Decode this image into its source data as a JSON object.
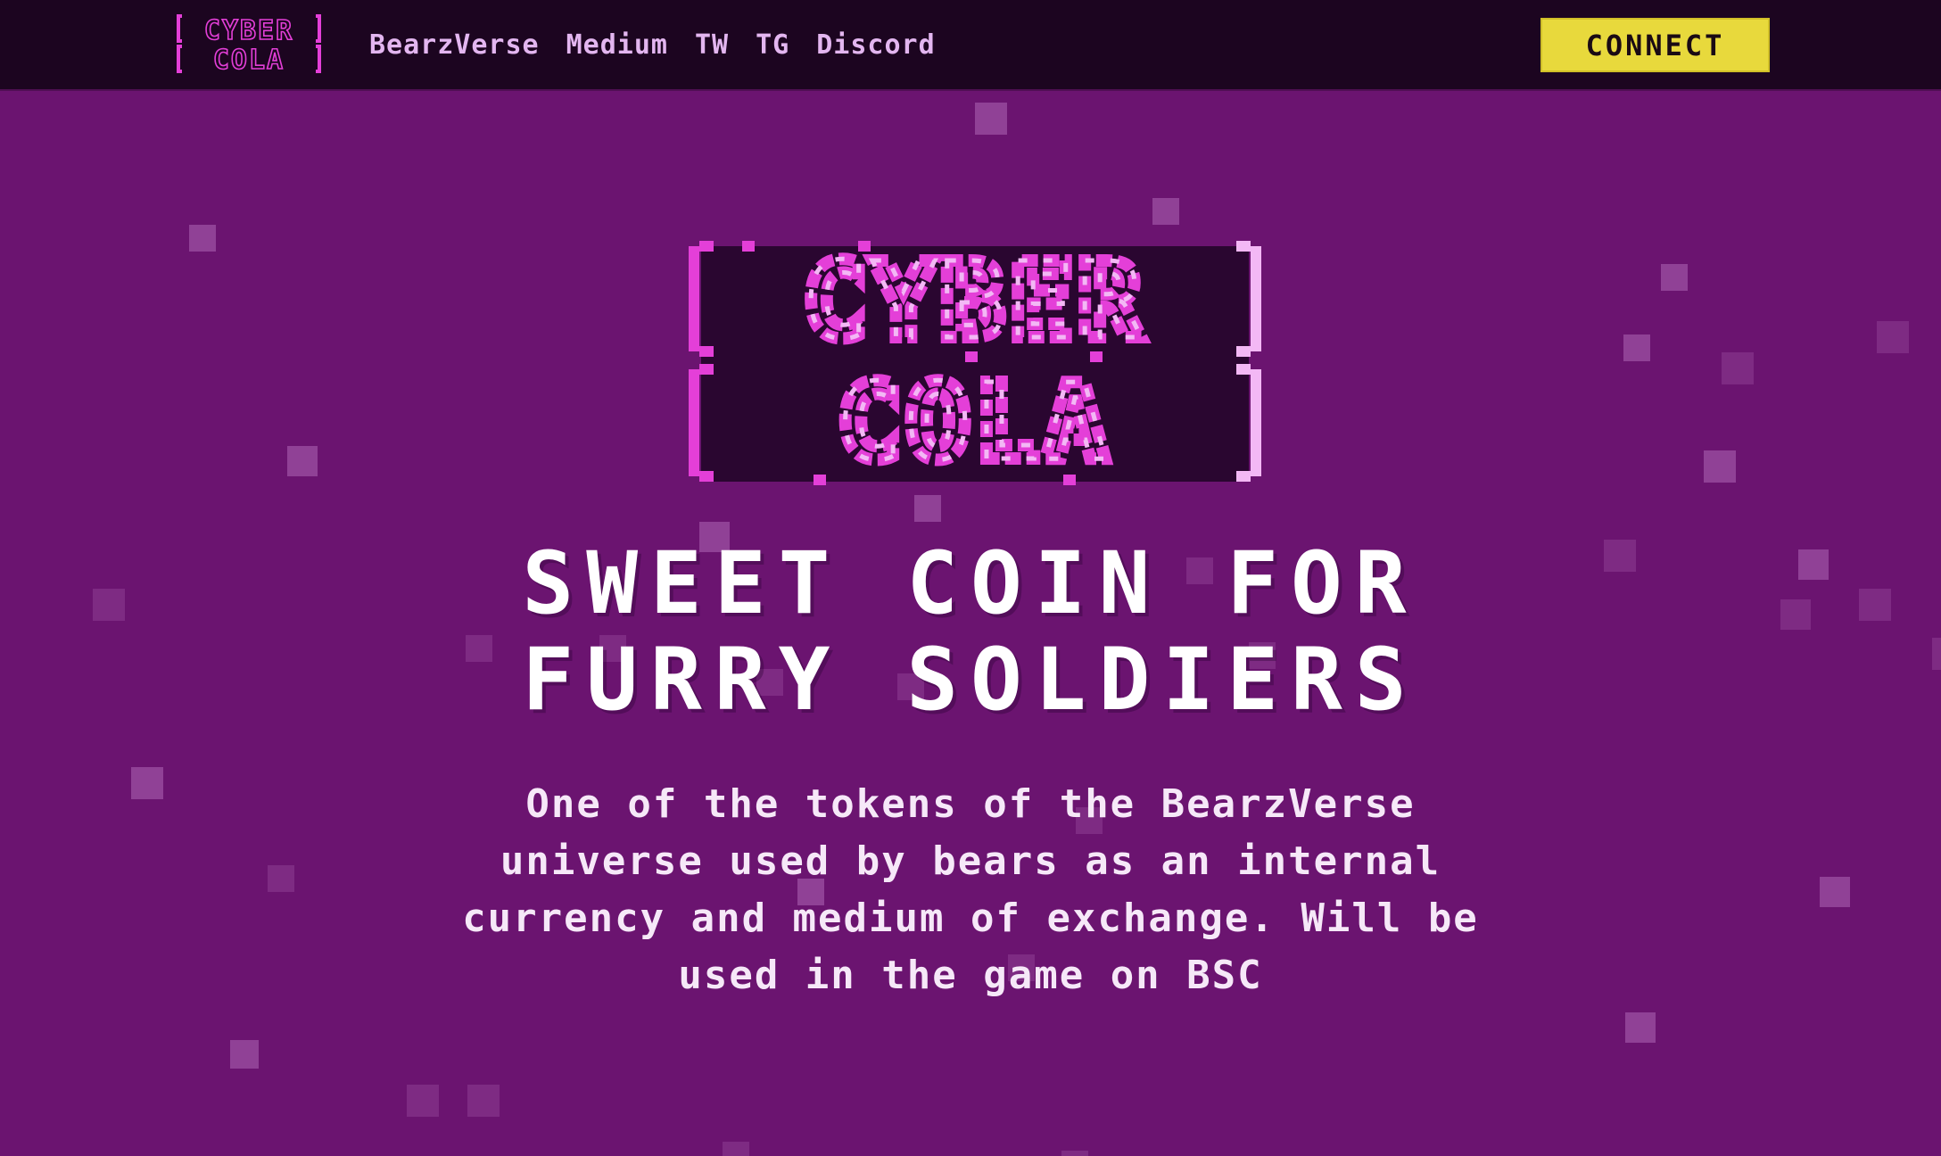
{
  "nav": {
    "logo_text": "CYBER COLA",
    "links": [
      "BearzVerse",
      "Medium",
      "TW",
      "TG",
      "Discord"
    ],
    "connect_label": "CONNECT"
  },
  "hero": {
    "logo_text": "CYBER COLA",
    "headline_line1": "SWEET COIN FOR",
    "headline_line2": "FURRY SOLDIERS",
    "description": "One of the tokens of the BearzVerse universe used by bears as an internal currency and medium of exchange. Will be used in the game on BSC"
  },
  "colors": {
    "background": "#6b1470",
    "topbar": "#1c0520",
    "accent_button": "#e8d93c",
    "logo_pink": "#e43fd8",
    "logo_light": "#f3b8f5",
    "text": "#ffffff"
  }
}
